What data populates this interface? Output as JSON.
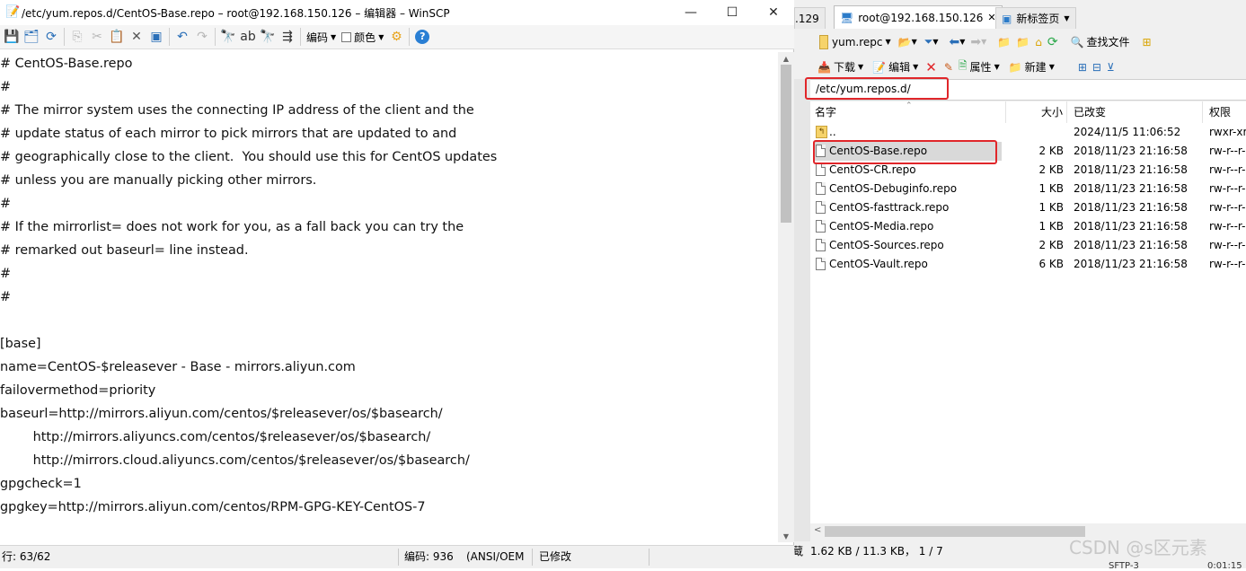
{
  "editor": {
    "title": "/etc/yum.repos.d/CentOS-Base.repo – root@192.168.150.126 – 编辑器 – WinSCP",
    "window_controls": {
      "minimize": "—",
      "maximize": "☐",
      "close": "✕"
    },
    "toolbar": {
      "encoding_label": "编码",
      "color_label": "颜色"
    },
    "lines": [
      "# CentOS-Base.repo",
      "#",
      "# The mirror system uses the connecting IP address of the client and the",
      "# update status of each mirror to pick mirrors that are updated to and",
      "# geographically close to the client.  You should use this for CentOS updates",
      "# unless you are manually picking other mirrors.",
      "#",
      "# If the mirrorlist= does not work for you, as a fall back you can try the",
      "# remarked out baseurl= line instead.",
      "#",
      "#",
      "",
      "[base]",
      "name=CentOS-$releasever - Base - mirrors.aliyun.com",
      "failovermethod=priority",
      "baseurl=http://mirrors.aliyun.com/centos/$releasever/os/$basearch/",
      "        http://mirrors.aliyuncs.com/centos/$releasever/os/$basearch/",
      "        http://mirrors.cloud.aliyuncs.com/centos/$releasever/os/$basearch/",
      "gpgcheck=1",
      "gpgkey=http://mirrors.aliyun.com/centos/RPM-GPG-KEY-CentOS-7"
    ],
    "status": {
      "position": "行: 63/62",
      "encoding": "编码: 936",
      "encoding_name": "(ANSI/OEM",
      "modified": "已修改"
    }
  },
  "main": {
    "tabs": [
      {
        "label": ".129"
      },
      {
        "label": "root@192.168.150.126",
        "close": "✕"
      },
      {
        "label": "新标签页"
      }
    ],
    "toolbar1": {
      "location": "yum.repc",
      "find_files": "查找文件"
    },
    "toolbar2": {
      "download": "下载",
      "edit": "编辑",
      "properties": "属性",
      "new": "新建"
    },
    "path": "/etc/yum.repos.d/",
    "columns": {
      "name": "名字",
      "size": "大小",
      "modified": "已改变",
      "permissions": "权限"
    },
    "files": [
      {
        "name": "..",
        "size": "",
        "modified": "2024/11/5 11:06:52",
        "perms": "rwxr-xr",
        "parent": true
      },
      {
        "name": "CentOS-Base.repo",
        "size": "2 KB",
        "modified": "2018/11/23 21:16:58",
        "perms": "rw-r--r-",
        "selected": true
      },
      {
        "name": "CentOS-CR.repo",
        "size": "2 KB",
        "modified": "2018/11/23 21:16:58",
        "perms": "rw-r--r-"
      },
      {
        "name": "CentOS-Debuginfo.repo",
        "size": "1 KB",
        "modified": "2018/11/23 21:16:58",
        "perms": "rw-r--r-"
      },
      {
        "name": "CentOS-fasttrack.repo",
        "size": "1 KB",
        "modified": "2018/11/23 21:16:58",
        "perms": "rw-r--r-"
      },
      {
        "name": "CentOS-Media.repo",
        "size": "1 KB",
        "modified": "2018/11/23 21:16:58",
        "perms": "rw-r--r-"
      },
      {
        "name": "CentOS-Sources.repo",
        "size": "2 KB",
        "modified": "2018/11/23 21:16:58",
        "perms": "rw-r--r-"
      },
      {
        "name": "CentOS-Vault.repo",
        "size": "6 KB",
        "modified": "2018/11/23 21:16:58",
        "perms": "rw-r--r-"
      }
    ],
    "status": {
      "left_char": "蔵",
      "summary": "1.62 KB / 11.3 KB，  1 / 7"
    },
    "bottom": {
      "protocol": "SFTP-3",
      "time": "0:01:15"
    },
    "watermark": "CSDN @s区元素"
  },
  "colors": {
    "highlight_red": "#e0262a",
    "selected_row": "#d9d9d9",
    "icon_blue": "#2a6fb8"
  }
}
